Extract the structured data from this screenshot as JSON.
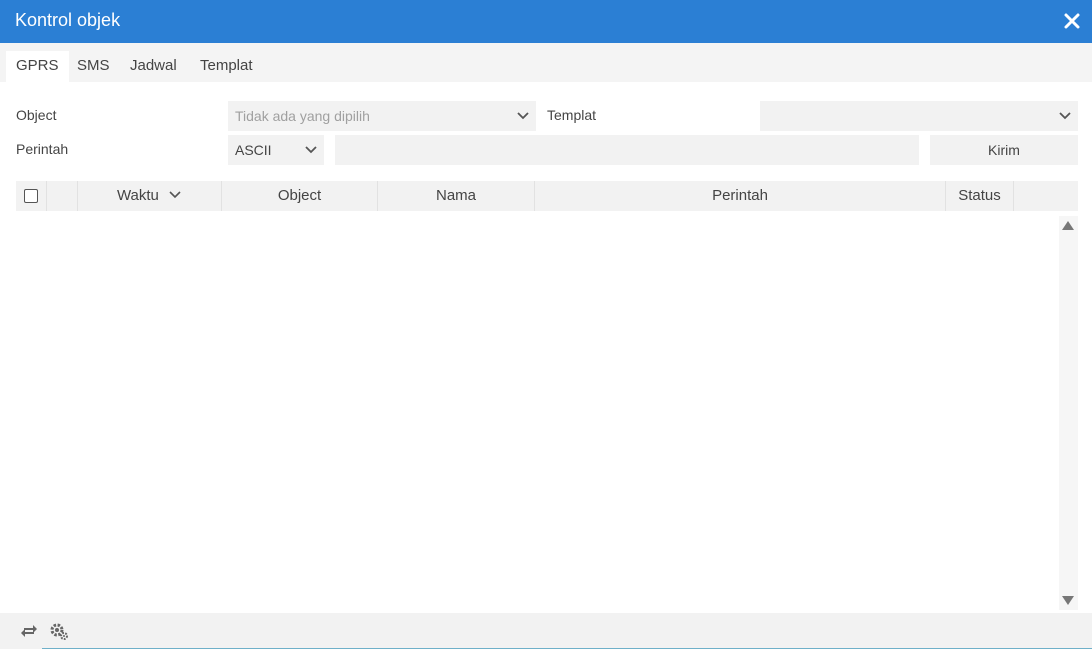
{
  "window": {
    "title": "Kontrol objek",
    "accent_color": "#2b7fd4"
  },
  "tabs": [
    {
      "label": "GPRS",
      "active": true
    },
    {
      "label": "SMS",
      "active": false
    },
    {
      "label": "Jadwal",
      "active": false
    },
    {
      "label": "Templat",
      "active": false
    }
  ],
  "form": {
    "object_label": "Object",
    "object_placeholder": "Tidak ada yang dipilih",
    "template_label": "Templat",
    "template_value": "",
    "command_label": "Perintah",
    "encoding_value": "ASCII",
    "command_value": "",
    "send_label": "Kirim"
  },
  "table": {
    "columns": [
      "Waktu",
      "Object",
      "Nama",
      "Perintah",
      "Status"
    ],
    "sort_column": "Waktu",
    "rows": []
  },
  "footer": {
    "icons": [
      "refresh-icon",
      "settings-icon"
    ]
  }
}
